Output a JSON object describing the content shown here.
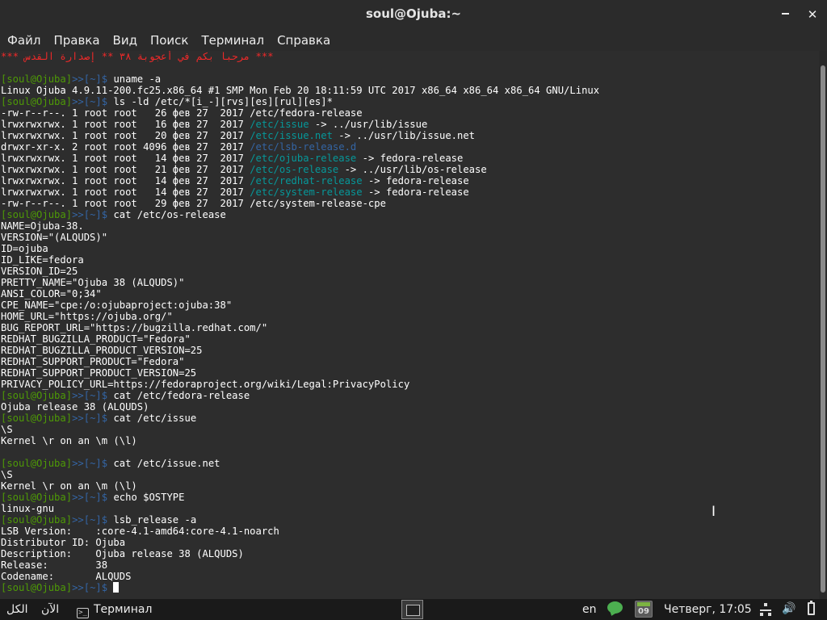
{
  "window": {
    "title": "soul@Ojuba:~",
    "minimize_glyph": "",
    "close_glyph": "✕"
  },
  "menu": [
    "Файл",
    "Правка",
    "Вид",
    "Поиск",
    "Терминал",
    "Справка"
  ],
  "terminal": {
    "prompt_user": "[soul@Ojuba]",
    "prompt_path": ">>[~]$ ",
    "lines": [
      {
        "t": "r",
        "s": "*** مرحبا بكم في أعجوبة ٣٨ ** إصدارة القدس ***"
      },
      {
        "t": "o",
        "s": ""
      },
      {
        "t": "c",
        "s": "uname -a"
      },
      {
        "t": "o",
        "s": "Linux Ojuba 4.9.11-200.fc25.x86_64 #1 SMP Mon Feb 20 18:11:59 UTC 2017 x86_64 x86_64 x86_64 GNU/Linux"
      },
      {
        "t": "c",
        "s": "ls -ld /etc/*[i_-][rvs][es][rul][es]*"
      },
      {
        "t": "ls",
        "pre": "-rw-r--r--. 1 root root   26 фев 27  2017 ",
        "name": "/etc/fedora-release",
        "cls": "",
        "post": ""
      },
      {
        "t": "ls",
        "pre": "lrwxrwxrwx. 1 root root   16 фев 27  2017 ",
        "name": "/etc/issue",
        "cls": "c",
        "post": " -> ../usr/lib/issue"
      },
      {
        "t": "ls",
        "pre": "lrwxrwxrwx. 1 root root   20 фев 27  2017 ",
        "name": "/etc/issue.net",
        "cls": "c",
        "post": " -> ../usr/lib/issue.net"
      },
      {
        "t": "ls",
        "pre": "drwxr-xr-x. 2 root root 4096 фев 27  2017 ",
        "name": "/etc/lsb-release.d",
        "cls": "b",
        "post": ""
      },
      {
        "t": "ls",
        "pre": "lrwxrwxrwx. 1 root root   14 фев 27  2017 ",
        "name": "/etc/ojuba-release",
        "cls": "c",
        "post": " -> fedora-release"
      },
      {
        "t": "ls",
        "pre": "lrwxrwxrwx. 1 root root   21 фев 27  2017 ",
        "name": "/etc/os-release",
        "cls": "c",
        "post": " -> ../usr/lib/os-release"
      },
      {
        "t": "ls",
        "pre": "lrwxrwxrwx. 1 root root   14 фев 27  2017 ",
        "name": "/etc/redhat-release",
        "cls": "c",
        "post": " -> fedora-release"
      },
      {
        "t": "ls",
        "pre": "lrwxrwxrwx. 1 root root   14 фев 27  2017 ",
        "name": "/etc/system-release",
        "cls": "c",
        "post": " -> fedora-release"
      },
      {
        "t": "ls",
        "pre": "-rw-r--r--. 1 root root   29 фев 27  2017 ",
        "name": "/etc/system-release-cpe",
        "cls": "",
        "post": ""
      },
      {
        "t": "c",
        "s": "cat /etc/os-release"
      },
      {
        "t": "o",
        "s": "NAME=Ojuba-38."
      },
      {
        "t": "o",
        "s": "VERSION=\"(ALQUDS)\""
      },
      {
        "t": "o",
        "s": "ID=ojuba"
      },
      {
        "t": "o",
        "s": "ID_LIKE=fedora"
      },
      {
        "t": "o",
        "s": "VERSION_ID=25"
      },
      {
        "t": "o",
        "s": "PRETTY_NAME=\"Ojuba 38 (ALQUDS)\""
      },
      {
        "t": "o",
        "s": "ANSI_COLOR=\"0;34\""
      },
      {
        "t": "o",
        "s": "CPE_NAME=\"cpe:/o:ojubaproject:ojuba:38\""
      },
      {
        "t": "o",
        "s": "HOME_URL=\"https://ojuba.org/\""
      },
      {
        "t": "o",
        "s": "BUG_REPORT_URL=\"https://bugzilla.redhat.com/\""
      },
      {
        "t": "o",
        "s": "REDHAT_BUGZILLA_PRODUCT=\"Fedora\""
      },
      {
        "t": "o",
        "s": "REDHAT_BUGZILLA_PRODUCT_VERSION=25"
      },
      {
        "t": "o",
        "s": "REDHAT_SUPPORT_PRODUCT=\"Fedora\""
      },
      {
        "t": "o",
        "s": "REDHAT_SUPPORT_PRODUCT_VERSION=25"
      },
      {
        "t": "o",
        "s": "PRIVACY_POLICY_URL=https://fedoraproject.org/wiki/Legal:PrivacyPolicy"
      },
      {
        "t": "c",
        "s": "cat /etc/fedora-release"
      },
      {
        "t": "o",
        "s": "Ojuba release 38 (ALQUDS)"
      },
      {
        "t": "c",
        "s": "cat /etc/issue"
      },
      {
        "t": "o",
        "s": "\\S"
      },
      {
        "t": "o",
        "s": "Kernel \\r on an \\m (\\l)"
      },
      {
        "t": "o",
        "s": ""
      },
      {
        "t": "c",
        "s": "cat /etc/issue.net"
      },
      {
        "t": "o",
        "s": "\\S"
      },
      {
        "t": "o",
        "s": "Kernel \\r on an \\m (\\l)"
      },
      {
        "t": "c",
        "s": "echo $OSTYPE"
      },
      {
        "t": "o",
        "s": "linux-gnu"
      },
      {
        "t": "c",
        "s": "lsb_release -a"
      },
      {
        "t": "o",
        "s": "LSB Version:\t:core-4.1-amd64:core-4.1-noarch"
      },
      {
        "t": "o",
        "s": "Distributor ID:\tOjuba"
      },
      {
        "t": "o",
        "s": "Description:\tOjuba release 38 (ALQUDS)"
      },
      {
        "t": "o",
        "s": "Release:\t38"
      },
      {
        "t": "o",
        "s": "Codename:\tALQUDS"
      },
      {
        "t": "cur",
        "s": ""
      }
    ]
  },
  "taskbar": {
    "all": "الكل",
    "now": "الآن",
    "terminal_label": "Терминал",
    "terminal_icon_glyph": ">_",
    "lang": "en",
    "calendar_day": "09",
    "clock": "Четверг, 17:05",
    "volume_glyph": "🔊"
  },
  "icons": {
    "chat": "chat-icon",
    "calendar": "calendar-icon",
    "network": "network-icon",
    "volume": "volume-icon",
    "battery": "battery-icon"
  }
}
